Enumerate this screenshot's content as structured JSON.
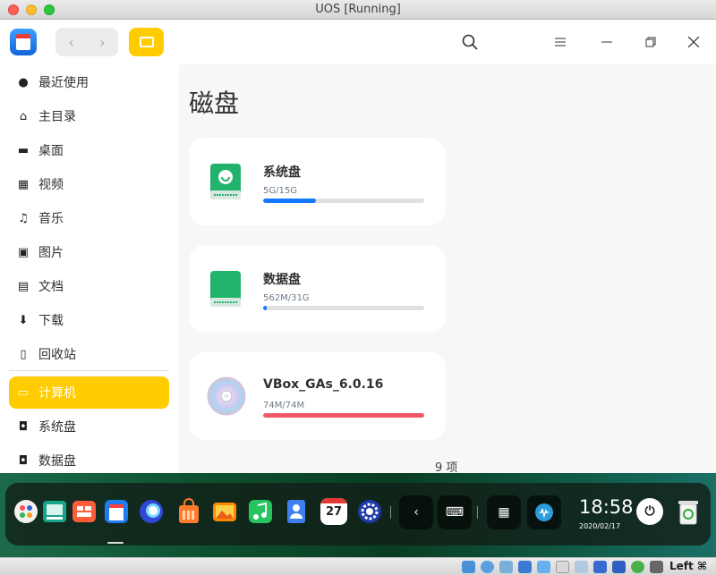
{
  "window": {
    "title": "UOS [Running]"
  },
  "toolbar": {
    "back_icon": "chevron-left-icon",
    "forward_icon": "chevron-right-icon",
    "view_icon": "monitor-icon",
    "search_icon": "search-icon",
    "menu_icon": "hamburger-menu-icon",
    "minimize_icon": "minimize-icon",
    "maximize_icon": "maximize-icon",
    "close_icon": "close-icon"
  },
  "sidebar": {
    "items": [
      {
        "label": "最近使用",
        "icon": "clock-icon"
      },
      {
        "label": "主目录",
        "icon": "home-icon"
      },
      {
        "label": "桌面",
        "icon": "desktop-icon"
      },
      {
        "label": "视频",
        "icon": "film-icon"
      },
      {
        "label": "音乐",
        "icon": "music-note-icon"
      },
      {
        "label": "图片",
        "icon": "image-icon"
      },
      {
        "label": "文档",
        "icon": "document-icon"
      },
      {
        "label": "下载",
        "icon": "download-icon"
      },
      {
        "label": "回收站",
        "icon": "trash-icon"
      },
      {
        "label": "计算机",
        "icon": "computer-icon",
        "active": true
      },
      {
        "label": "系统盘",
        "icon": "disk-icon"
      },
      {
        "label": "数据盘",
        "icon": "disk-icon"
      }
    ]
  },
  "main": {
    "title": "磁盘",
    "disks": [
      {
        "name": "系统盘",
        "size": "5G/15G",
        "usage": 0.33,
        "icon": "system-disk-icon",
        "bar_color": "#1677ff"
      },
      {
        "name": "数据盘",
        "size": "562M/31G",
        "usage": 0.02,
        "icon": "data-disk-icon",
        "bar_color": "#1677ff"
      },
      {
        "name": "VBox_GAs_6.0.16",
        "size": "74M/74M",
        "usage": 1.0,
        "icon": "optical-disc-icon",
        "bar_color": "#f25767"
      }
    ],
    "item_count": "9 项"
  },
  "dock": {
    "apps": [
      "launcher-icon",
      "multitasking-view-icon",
      "app-store-icon",
      "file-manager-icon",
      "browser-icon",
      "shopping-bag-icon",
      "image-viewer-icon",
      "music-player-icon",
      "contacts-icon",
      "calendar-icon",
      "settings-icon"
    ],
    "calendar_day": "27",
    "clock": {
      "time": "18:58",
      "date": "2020/02/17"
    }
  },
  "vbox_status": {
    "host_key": "Left ⌘"
  },
  "colors": {
    "accent": "#ffcc00",
    "blue_bar": "#1677ff",
    "red_bar": "#f25767"
  }
}
